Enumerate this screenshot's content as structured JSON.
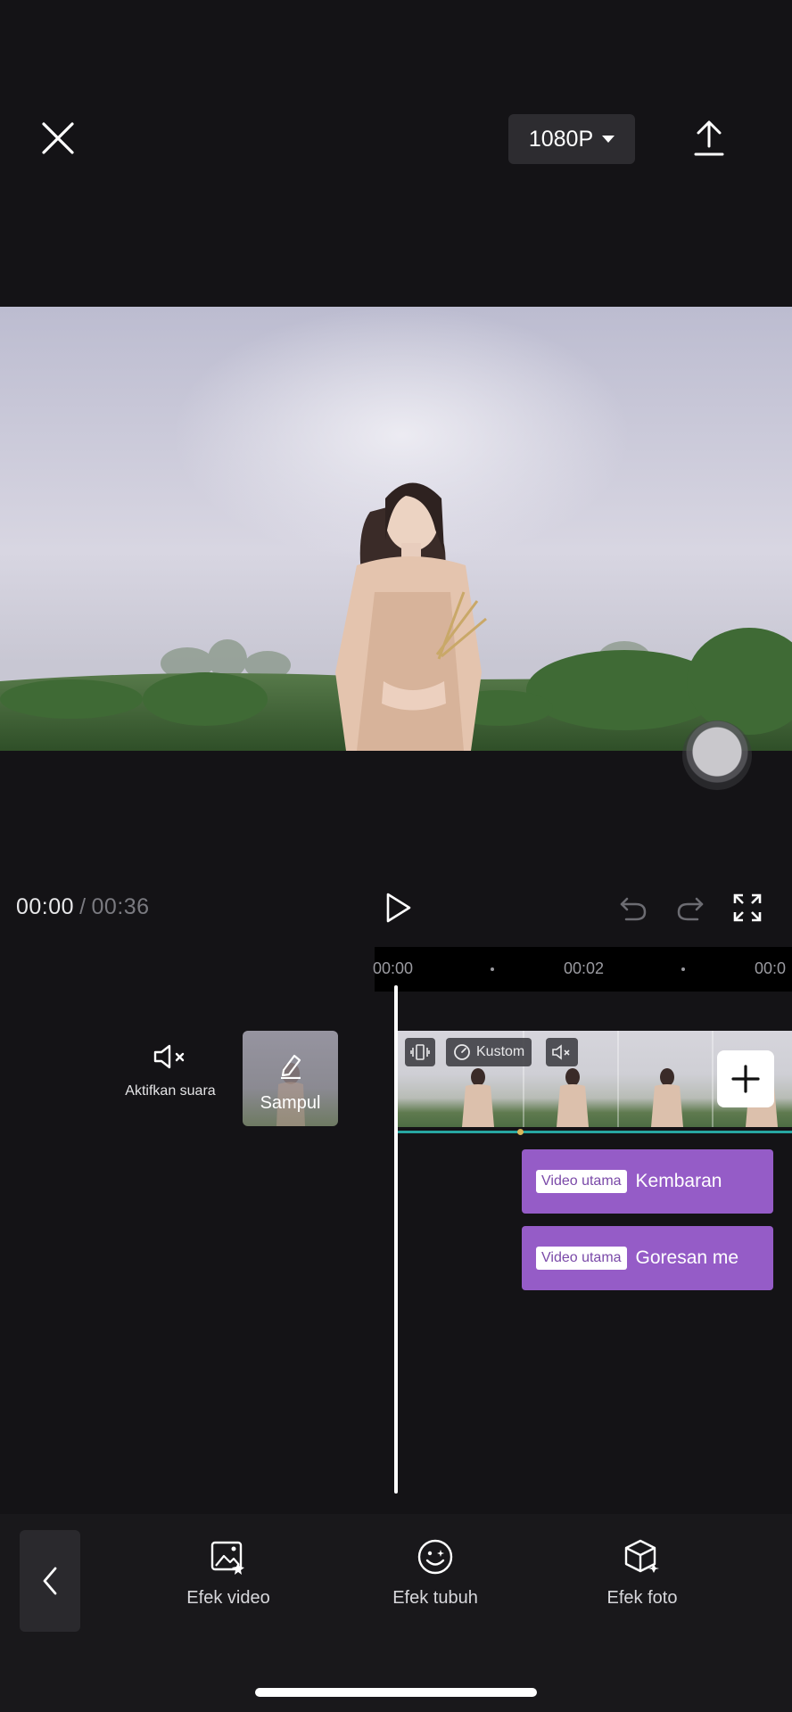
{
  "top_bar": {
    "resolution_label": "1080P"
  },
  "playback": {
    "current_time": "00:00",
    "separator": "/",
    "total_time": "00:36"
  },
  "timeline": {
    "ticks": [
      "00:00",
      "00:02",
      "00:0"
    ],
    "mute_label": "Aktifkan suara",
    "cover_label": "Sampul",
    "clip_chip_label": "Kustom",
    "effects": [
      {
        "tag": "Video utama",
        "name": "Kembaran"
      },
      {
        "tag": "Video utama",
        "name": "Goresan me"
      }
    ],
    "track_color": "#27a6a1",
    "effect_color": "#955cc7"
  },
  "toolbar": {
    "items": [
      {
        "label": "Efek video",
        "icon": "video-effect-icon"
      },
      {
        "label": "Efek tubuh",
        "icon": "body-effect-icon"
      },
      {
        "label": "Efek foto",
        "icon": "photo-effect-icon"
      }
    ]
  }
}
